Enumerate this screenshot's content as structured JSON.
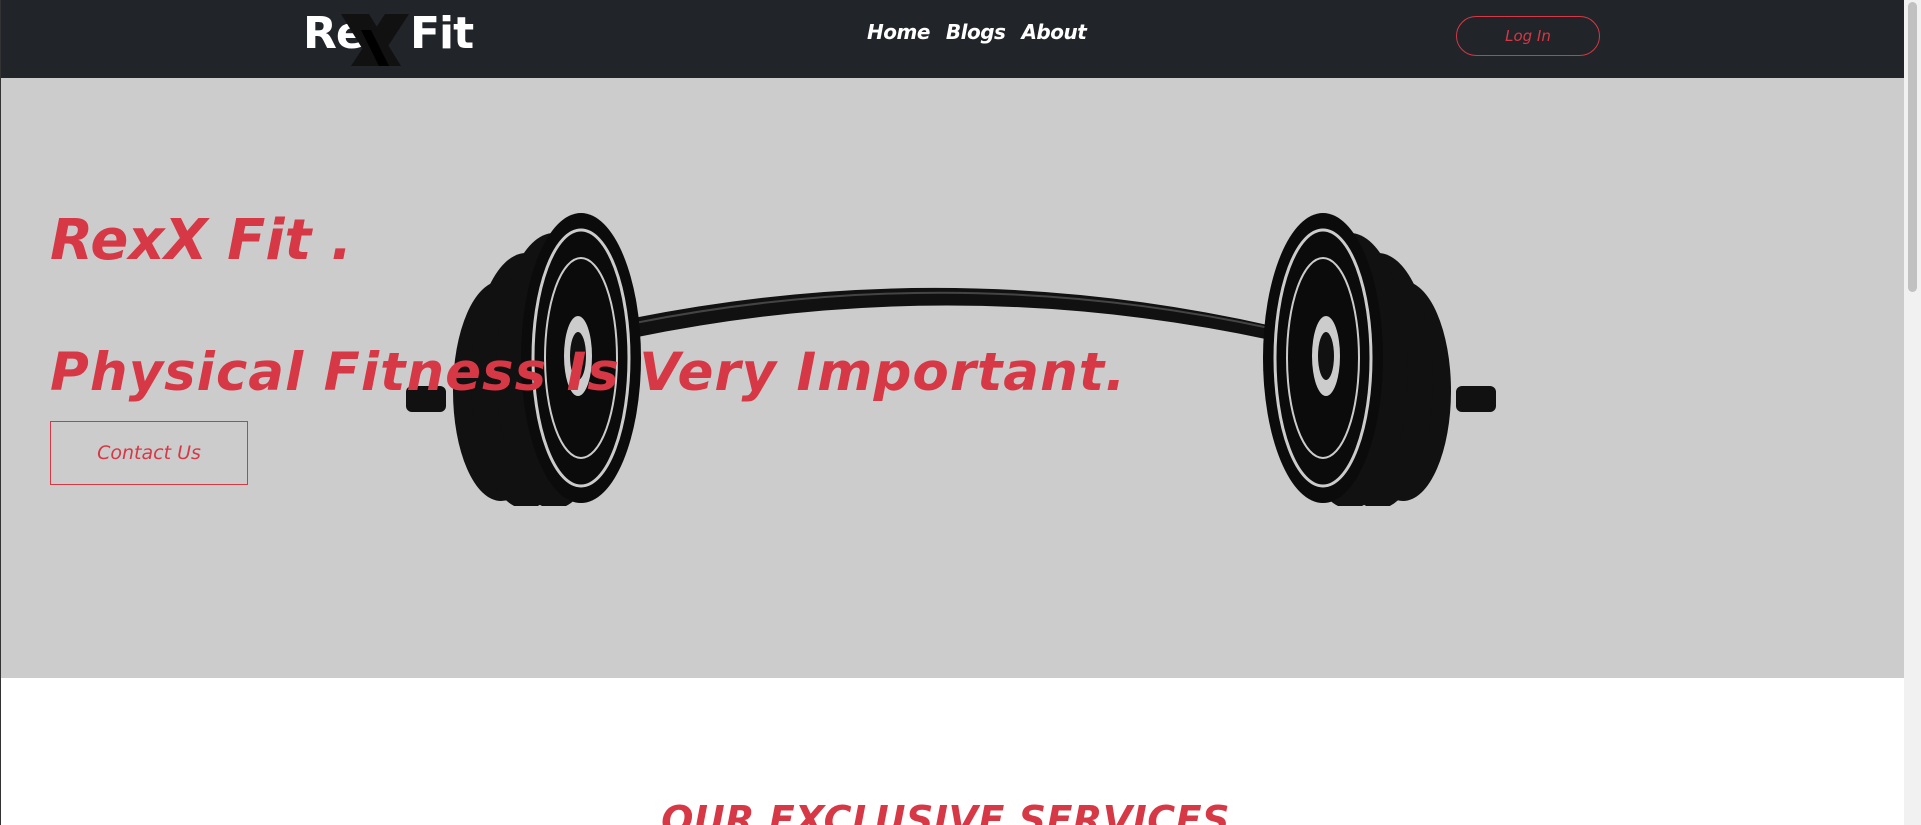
{
  "navbar": {
    "logo": {
      "left_text": "Re",
      "right_text": "Fit",
      "mark": "X"
    },
    "links": [
      {
        "label": "Home"
      },
      {
        "label": "Blogs"
      },
      {
        "label": "About"
      }
    ],
    "login_label": "Log In"
  },
  "hero": {
    "title": "RexX Fit .",
    "subtitle": "Physical Fitness Is Very Important.",
    "contact_label": "Contact Us",
    "image": "barbell-illustration"
  },
  "services": {
    "heading": "OUR EXCLUSIVE SERVICES."
  },
  "colors": {
    "accent": "#d63845",
    "navbar_bg": "#212429",
    "hero_bg": "#cccccc"
  }
}
